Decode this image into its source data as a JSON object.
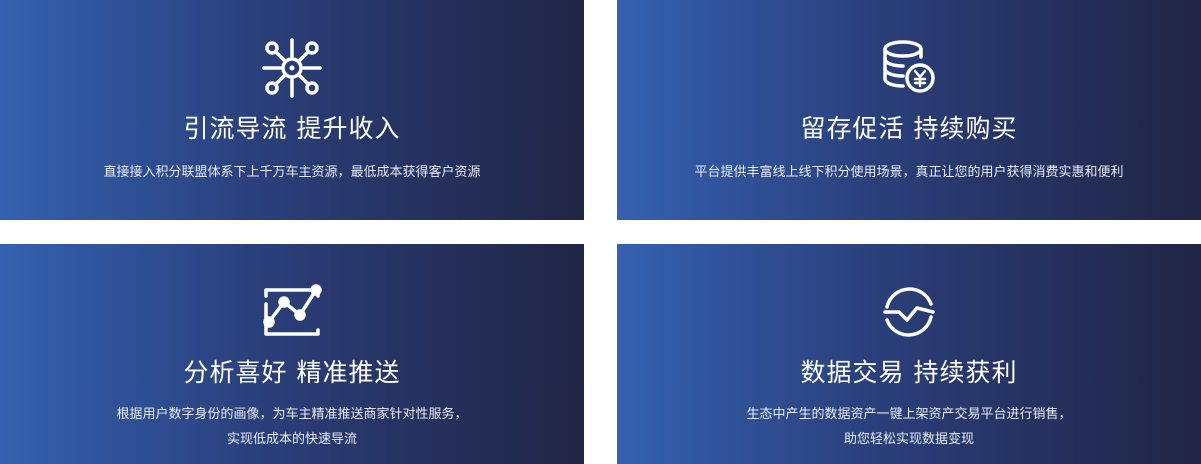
{
  "cards": [
    {
      "icon": "network-nodes-icon",
      "title": "引流导流  提升收入",
      "desc": [
        "直接接入积分联盟体系下上千万车主资源，最低成本获得客户资源"
      ]
    },
    {
      "icon": "coin-stack-yen-icon",
      "title": "留存促活  持续购买",
      "desc": [
        "平台提供丰富线上线下积分使用场景，真正让您的用户获得消费实惠和便利"
      ]
    },
    {
      "icon": "trend-chart-icon",
      "title": "分析喜好  精准推送",
      "desc": [
        "根据用户数字身份的画像，为车主精准推送商家针对性服务，",
        "实现低成本的快速导流"
      ]
    },
    {
      "icon": "exchange-cycle-icon",
      "title": "数据交易 持续获利",
      "desc": [
        "生态中产生的数据资产一键上架资产交易平台进行销售，",
        "助您轻松实现数据变现"
      ]
    }
  ],
  "colors": {
    "gradient_start": "#3461b0",
    "gradient_end": "#212444",
    "text": "#ffffff"
  }
}
